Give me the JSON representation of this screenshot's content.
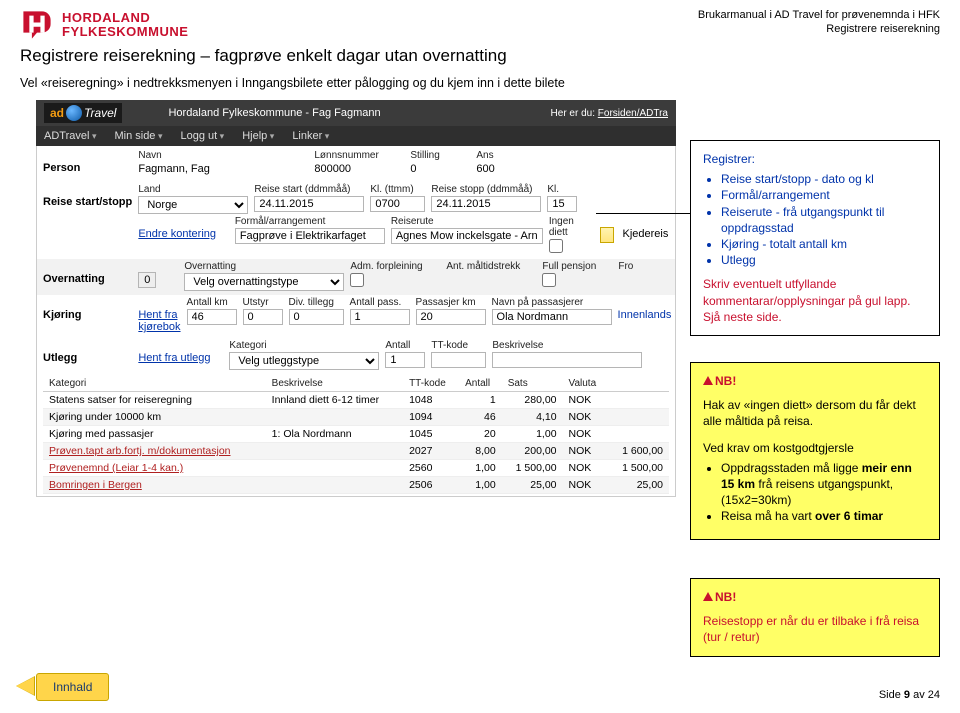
{
  "header": {
    "org_line1": "HORDALAND",
    "org_line2": "FYLKESKOMMUNE",
    "right_line1": "Brukarmanual i AD Travel for prøvenemnda i HFK",
    "right_line2": "Registrere reiserekning"
  },
  "title": "Registrere reiserekning – fagprøve enkelt dagar utan overnatting",
  "subtitle": "Vel «reiseregning» i nedtrekksmenyen i Inngangsbilete etter pålogging og du kjem inn i dette bilete",
  "ss": {
    "app_title": "Hordaland Fylkeskommune - Fag Fagmann",
    "breadcrumb_prefix": "Her er du:",
    "breadcrumb": "Forsiden/ADTra",
    "nav": [
      "ADTravel",
      "Min side",
      "Logg ut",
      "Hjelp",
      "Linker"
    ],
    "logo_text_a": "ad",
    "logo_text_b": "Travel",
    "person": {
      "section": "Person",
      "navn_lbl": "Navn",
      "navn": "Fagmann, Fag",
      "lonn_lbl": "Lønnsnummer",
      "lonn": "800000",
      "stilling_lbl": "Stilling",
      "stilling": "0",
      "ans_lbl": "Ans",
      "ans": "600"
    },
    "startstop": {
      "section": "Reise start/stopp",
      "land_lbl": "Land",
      "land": "Norge",
      "start_lbl": "Reise start (ddmmåå)",
      "start": "24.11.2015",
      "kl1_lbl": "Kl. (ttmm)",
      "kl1": "0700",
      "stopp_lbl": "Reise stopp (ddmmåå)",
      "stopp": "24.11.2015",
      "kl2_lbl": "Kl.",
      "kl2": "15",
      "endre_lbl": "Endre kontering",
      "formal_lbl": "Formål/arrangement",
      "formal": "Fagprøve i Elektrikarfaget",
      "reiserute_lbl": "Reiserute",
      "reiserute": "Agnes Mow inckelsgate - Arna t/r",
      "ingen_diett_lbl": "Ingen diett",
      "kjedereis": "Kjedereis"
    },
    "overnatting": {
      "section": "Overnatting",
      "overn_lbl": "Overnatting",
      "overn_select": "Velg overnattingstype",
      "adm_lbl": "Adm. forpleining",
      "pensjon_lbl": "Full pensjon",
      "fro_lbl": "Fro",
      "tidstrekk_lbl": "Ant. måltidstrekk"
    },
    "kjoring": {
      "section": "Kjøring",
      "hent_lbl": "Hent fra kjørebok",
      "km_lbl": "Antall km",
      "km": "46",
      "utstyr_lbl": "Utstyr",
      "utstyr": "0",
      "div_lbl": "Div. tillegg",
      "div": "0",
      "pass_lbl": "Antall pass.",
      "pass": "1",
      "passkm_lbl": "Passasjer km",
      "passkm": "20",
      "navnpass_lbl": "Navn på passasjerer",
      "navnpass": "Ola Nordmann",
      "innenlands": "Innenlands"
    },
    "utlegg": {
      "section": "Utlegg",
      "hent_lbl": "Hent fra utlegg",
      "kat_lbl": "Kategori",
      "kat_select": "Velg utleggstype",
      "ant_lbl": "Antall",
      "ant": "1",
      "tt_lbl": "TT-kode",
      "beskr_lbl": "Beskrivelse"
    },
    "summary": {
      "kategori_lbl": "Kategori",
      "beskrivelse_lbl": "Beskrivelse",
      "ttkode_lbl": "TT-kode",
      "antall_lbl": "Antall",
      "sats_lbl": "Sats",
      "valuta_lbl": "Valuta",
      "rows": [
        {
          "kat": "Statens satser for reiseregning",
          "beskr": "Innland diett 6-12 timer",
          "tt": "1048",
          "ant": "1",
          "sats": "280,00",
          "val": "NOK"
        },
        {
          "kat": "Kjøring under 10000 km",
          "beskr": "",
          "tt": "1094",
          "ant": "46",
          "sats": "4,10",
          "val": "NOK"
        },
        {
          "kat": "Kjøring med passasjer",
          "beskr": "1: Ola Nordmann",
          "tt": "1045",
          "ant": "20",
          "sats": "1,00",
          "val": "NOK"
        },
        {
          "kat": "Prøven.tapt arb.fortj. m/dokumentasjon",
          "beskr": "",
          "tt": "2027",
          "ant": "8,00",
          "sats": "200,00",
          "val": "NOK",
          "sum": "1 600,00"
        },
        {
          "kat": "Prøvenemnd (Leiar 1-4 kan.)",
          "beskr": "",
          "tt": "2560",
          "ant": "1,00",
          "sats": "1 500,00",
          "val": "NOK",
          "sum": "1 500,00"
        },
        {
          "kat": "Bomringen i Bergen",
          "beskr": "",
          "tt": "2506",
          "ant": "1,00",
          "sats": "25,00",
          "val": "NOK",
          "sum": "25,00"
        }
      ]
    }
  },
  "callouts": {
    "registrer_title": "Registrer:",
    "registrer_items": [
      "Reise start/stopp - dato og kl",
      "Formål/arrangement",
      "Reiserute - frå utgangspunkt til oppdragsstad",
      "Kjøring - totalt antall km",
      "Utlegg"
    ],
    "sub_text": "Skriv eventuelt utfyllande kommentarar/opplysningar på gul lapp. Sjå neste side.",
    "nb1_title": "NB!",
    "nb1_line1": "Hak av «ingen diett» dersom du får dekt alle måltida på reisa.",
    "nb1_line2": "Ved krav om kostgodtgjersle",
    "nb1_items": [
      "Oppdragsstaden må ligge meir enn 15 km frå reisens utgangspunkt, (15x2=30km)",
      "Reisa må ha vart over 6 timar"
    ],
    "nb1_bold_a": "meir enn 15 km",
    "nb1_bold_b": "over 6 timar",
    "nb2_title": "NB!",
    "nb2_text": "Reisestopp er når du er tilbake i frå reisa (tur / retur)"
  },
  "footer": {
    "innhald": "Innhald",
    "page_prefix": "Side ",
    "page_current": "9",
    "page_sep": " av ",
    "page_total": "24"
  }
}
